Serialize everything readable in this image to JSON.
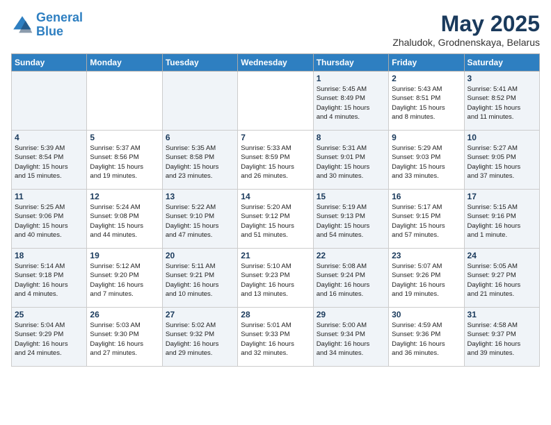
{
  "header": {
    "logo_line1": "General",
    "logo_line2": "Blue",
    "title": "May 2025",
    "subtitle": "Zhaludok, Grodnenskaya, Belarus"
  },
  "weekdays": [
    "Sunday",
    "Monday",
    "Tuesday",
    "Wednesday",
    "Thursday",
    "Friday",
    "Saturday"
  ],
  "weeks": [
    [
      {
        "day": "",
        "info": ""
      },
      {
        "day": "",
        "info": ""
      },
      {
        "day": "",
        "info": ""
      },
      {
        "day": "",
        "info": ""
      },
      {
        "day": "1",
        "info": "Sunrise: 5:45 AM\nSunset: 8:49 PM\nDaylight: 15 hours\nand 4 minutes."
      },
      {
        "day": "2",
        "info": "Sunrise: 5:43 AM\nSunset: 8:51 PM\nDaylight: 15 hours\nand 8 minutes."
      },
      {
        "day": "3",
        "info": "Sunrise: 5:41 AM\nSunset: 8:52 PM\nDaylight: 15 hours\nand 11 minutes."
      }
    ],
    [
      {
        "day": "4",
        "info": "Sunrise: 5:39 AM\nSunset: 8:54 PM\nDaylight: 15 hours\nand 15 minutes."
      },
      {
        "day": "5",
        "info": "Sunrise: 5:37 AM\nSunset: 8:56 PM\nDaylight: 15 hours\nand 19 minutes."
      },
      {
        "day": "6",
        "info": "Sunrise: 5:35 AM\nSunset: 8:58 PM\nDaylight: 15 hours\nand 23 minutes."
      },
      {
        "day": "7",
        "info": "Sunrise: 5:33 AM\nSunset: 8:59 PM\nDaylight: 15 hours\nand 26 minutes."
      },
      {
        "day": "8",
        "info": "Sunrise: 5:31 AM\nSunset: 9:01 PM\nDaylight: 15 hours\nand 30 minutes."
      },
      {
        "day": "9",
        "info": "Sunrise: 5:29 AM\nSunset: 9:03 PM\nDaylight: 15 hours\nand 33 minutes."
      },
      {
        "day": "10",
        "info": "Sunrise: 5:27 AM\nSunset: 9:05 PM\nDaylight: 15 hours\nand 37 minutes."
      }
    ],
    [
      {
        "day": "11",
        "info": "Sunrise: 5:25 AM\nSunset: 9:06 PM\nDaylight: 15 hours\nand 40 minutes."
      },
      {
        "day": "12",
        "info": "Sunrise: 5:24 AM\nSunset: 9:08 PM\nDaylight: 15 hours\nand 44 minutes."
      },
      {
        "day": "13",
        "info": "Sunrise: 5:22 AM\nSunset: 9:10 PM\nDaylight: 15 hours\nand 47 minutes."
      },
      {
        "day": "14",
        "info": "Sunrise: 5:20 AM\nSunset: 9:12 PM\nDaylight: 15 hours\nand 51 minutes."
      },
      {
        "day": "15",
        "info": "Sunrise: 5:19 AM\nSunset: 9:13 PM\nDaylight: 15 hours\nand 54 minutes."
      },
      {
        "day": "16",
        "info": "Sunrise: 5:17 AM\nSunset: 9:15 PM\nDaylight: 15 hours\nand 57 minutes."
      },
      {
        "day": "17",
        "info": "Sunrise: 5:15 AM\nSunset: 9:16 PM\nDaylight: 16 hours\nand 1 minute."
      }
    ],
    [
      {
        "day": "18",
        "info": "Sunrise: 5:14 AM\nSunset: 9:18 PM\nDaylight: 16 hours\nand 4 minutes."
      },
      {
        "day": "19",
        "info": "Sunrise: 5:12 AM\nSunset: 9:20 PM\nDaylight: 16 hours\nand 7 minutes."
      },
      {
        "day": "20",
        "info": "Sunrise: 5:11 AM\nSunset: 9:21 PM\nDaylight: 16 hours\nand 10 minutes."
      },
      {
        "day": "21",
        "info": "Sunrise: 5:10 AM\nSunset: 9:23 PM\nDaylight: 16 hours\nand 13 minutes."
      },
      {
        "day": "22",
        "info": "Sunrise: 5:08 AM\nSunset: 9:24 PM\nDaylight: 16 hours\nand 16 minutes."
      },
      {
        "day": "23",
        "info": "Sunrise: 5:07 AM\nSunset: 9:26 PM\nDaylight: 16 hours\nand 19 minutes."
      },
      {
        "day": "24",
        "info": "Sunrise: 5:05 AM\nSunset: 9:27 PM\nDaylight: 16 hours\nand 21 minutes."
      }
    ],
    [
      {
        "day": "25",
        "info": "Sunrise: 5:04 AM\nSunset: 9:29 PM\nDaylight: 16 hours\nand 24 minutes."
      },
      {
        "day": "26",
        "info": "Sunrise: 5:03 AM\nSunset: 9:30 PM\nDaylight: 16 hours\nand 27 minutes."
      },
      {
        "day": "27",
        "info": "Sunrise: 5:02 AM\nSunset: 9:32 PM\nDaylight: 16 hours\nand 29 minutes."
      },
      {
        "day": "28",
        "info": "Sunrise: 5:01 AM\nSunset: 9:33 PM\nDaylight: 16 hours\nand 32 minutes."
      },
      {
        "day": "29",
        "info": "Sunrise: 5:00 AM\nSunset: 9:34 PM\nDaylight: 16 hours\nand 34 minutes."
      },
      {
        "day": "30",
        "info": "Sunrise: 4:59 AM\nSunset: 9:36 PM\nDaylight: 16 hours\nand 36 minutes."
      },
      {
        "day": "31",
        "info": "Sunrise: 4:58 AM\nSunset: 9:37 PM\nDaylight: 16 hours\nand 39 minutes."
      }
    ]
  ]
}
